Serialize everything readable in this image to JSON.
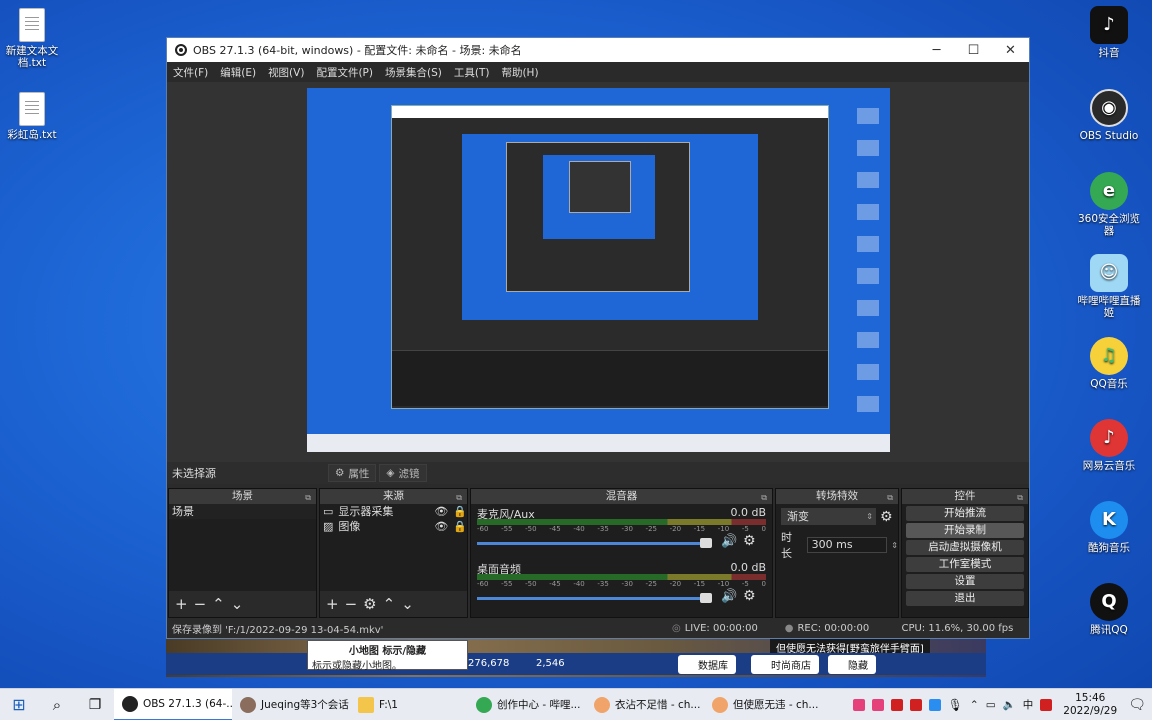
{
  "desktop": {
    "left_icons": [
      {
        "label": "新建文本文档.txt"
      },
      {
        "label": "彩虹岛.txt"
      }
    ],
    "right_icons": [
      {
        "label": "抖音",
        "color": "#111111"
      },
      {
        "label": "OBS Studio",
        "color": "#2a2a2a"
      },
      {
        "label": "360安全浏览器",
        "color": "#34a853"
      },
      {
        "label": "哔哩哔哩直播姬",
        "color": "#66c1ef"
      },
      {
        "label": "QQ音乐",
        "color": "#31c27c"
      },
      {
        "label": "网易云音乐",
        "color": "#e03535"
      },
      {
        "label": "酷狗音乐",
        "color": "#1d8ef0"
      },
      {
        "label": "腾讯QQ",
        "color": "#111111"
      }
    ]
  },
  "window": {
    "title": "OBS 27.1.3 (64-bit, windows) - 配置文件: 未命名 - 场景: 未命名",
    "menu": [
      "文件(F)",
      "编辑(E)",
      "视图(V)",
      "配置文件(P)",
      "场景集合(S)",
      "工具(T)",
      "帮助(H)"
    ]
  },
  "source_bar": {
    "no_selection": "未选择源",
    "properties": "属性",
    "filters": "滤镜"
  },
  "docks": {
    "scenes": {
      "title": "场景",
      "items": [
        "场景"
      ]
    },
    "sources": {
      "title": "来源",
      "items": [
        "显示器采集",
        "图像"
      ]
    },
    "mixer": {
      "title": "混音器",
      "channels": [
        {
          "name": "麦克风/Aux",
          "db": "0.0 dB"
        },
        {
          "name": "桌面音频",
          "db": "0.0 dB"
        }
      ],
      "ticks": [
        "-60",
        "-55",
        "-50",
        "-45",
        "-40",
        "-35",
        "-30",
        "-25",
        "-20",
        "-15",
        "-10",
        "-5",
        "0"
      ]
    },
    "transitions": {
      "title": "转场特效",
      "type": "渐变",
      "duration_label": "时长",
      "duration": "300 ms"
    },
    "controls": {
      "title": "控件",
      "buttons": [
        "开始推流",
        "开始录制",
        "启动虚拟摄像机",
        "工作室模式",
        "设置",
        "退出"
      ]
    }
  },
  "status": {
    "saved": "保存录像到 'F:/1/2022-09-29 13-04-54.mkv'",
    "live": "LIVE: 00:00:00",
    "rec": "REC: 00:00:00",
    "cpu": "CPU: 11.6%, 30.00 fps"
  },
  "overlay": {
    "tooltip_title": "小地图 标示/隐藏",
    "tooltip_text": "标示或隐藏小地图。",
    "game_banner": "但使愿无法获得[野蛮旅伴手臂面]",
    "stat1": "276,678",
    "stat2": "2,546",
    "game_btns": [
      "数据库",
      "时尚商店",
      "隐藏"
    ]
  },
  "taskbar": {
    "items": [
      "OBS 27.1.3 (64-...",
      "Jueqing等3个会话",
      "F:\\1",
      "创作中心 - 哔哩...",
      "衣沾不足惜 - ch...",
      "但使愿无违 - ch..."
    ],
    "time": "15:46",
    "date": "2022/9/29",
    "ime": "中"
  }
}
